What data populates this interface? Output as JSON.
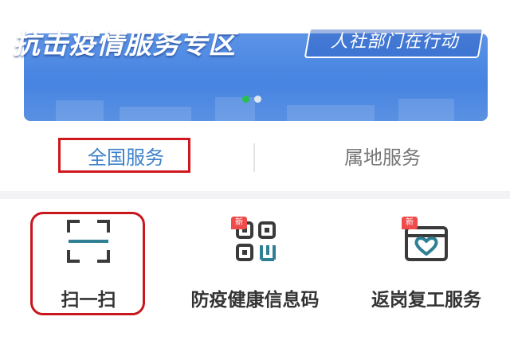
{
  "banner": {
    "title": "抗击疫情服务专区",
    "subtitle": "人社部门在行动",
    "slide_count": 2,
    "active_slide": 1
  },
  "tabs": {
    "national": "全国服务",
    "local": "属地服务"
  },
  "services": {
    "scan": {
      "label": "扫一扫",
      "icon": "scan-icon"
    },
    "health_code": {
      "label": "防疫健康信息码",
      "icon": "qr-code-icon",
      "badge": "新"
    },
    "return_work": {
      "label": "返岗复工服务",
      "icon": "heart-briefcase-icon",
      "badge": "新"
    }
  },
  "colors": {
    "accent_blue": "#3e82c9",
    "highlight_red": "#d0171d",
    "active_dot": "#27c04e",
    "icon_teal": "#2f7f95"
  }
}
